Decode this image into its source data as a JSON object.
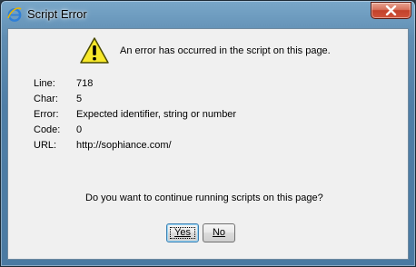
{
  "window": {
    "title": "Script Error",
    "icon": "internet-explorer-icon",
    "close_icon": "close-icon"
  },
  "dialog": {
    "warning_icon": "warning-icon",
    "message": "An error has occurred in the script on this page.",
    "details": [
      {
        "label": "Line:",
        "value": "718"
      },
      {
        "label": "Char:",
        "value": "5"
      },
      {
        "label": "Error:",
        "value": "Expected identifier, string or number"
      },
      {
        "label": "Code:",
        "value": "0"
      },
      {
        "label": "URL:",
        "value": "http://sophiance.com/"
      }
    ],
    "question": "Do you want to continue running scripts on this page?",
    "buttons": {
      "yes_label": "Yes",
      "no_label": "No"
    }
  },
  "colors": {
    "titlebar": "#5f8db2",
    "close_button": "#c2412a",
    "client_bg": "#f0f0f0",
    "warning_yellow": "#f7e82a"
  }
}
